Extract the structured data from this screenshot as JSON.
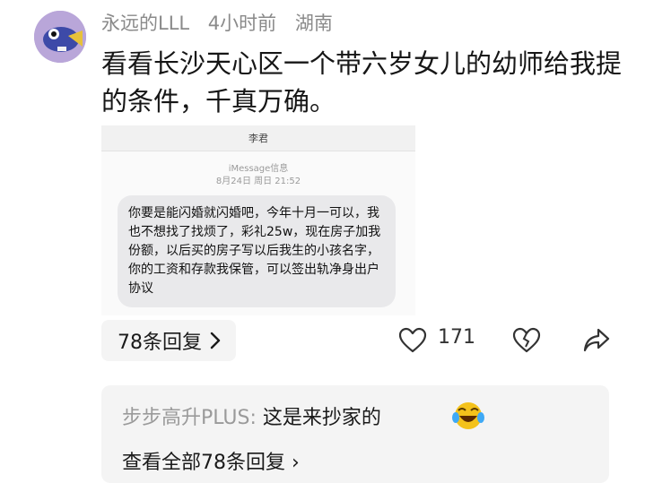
{
  "comment": {
    "username": "永远的LLL",
    "time": "4小时前",
    "location": "湖南",
    "text": "看看长沙天心区一个带六岁女儿的幼师给我提的条件，千真万确。"
  },
  "screenshot": {
    "contact_name": "李君",
    "service": "iMessage信息",
    "datetime": "8月24日 周日 21:52",
    "message": "你要是能闪婚就闪婚吧，今年十月一可以，我也不想找了找烦了，彩礼25w，现在房子加我份额，以后买的房子写以后我生的小孩名字，你的工资和存款我保管，可以签出轨净身出户协议"
  },
  "actions": {
    "replies_label": "78条回复",
    "like_count": "171"
  },
  "top_reply": {
    "username": "步步高升PLUS",
    "separator": ": ",
    "text": "这是来抄家的",
    "view_all": "查看全部78条回复"
  },
  "colors": {
    "avatar_bg": "#b9a6d9",
    "muted_text": "#8a8a8a",
    "bubble_bg": "#e9e9eb"
  },
  "icons": [
    "avatar-icon",
    "chevron-right-icon",
    "heart-icon",
    "broken-heart-icon",
    "share-icon",
    "laugh-cry-emoji"
  ]
}
